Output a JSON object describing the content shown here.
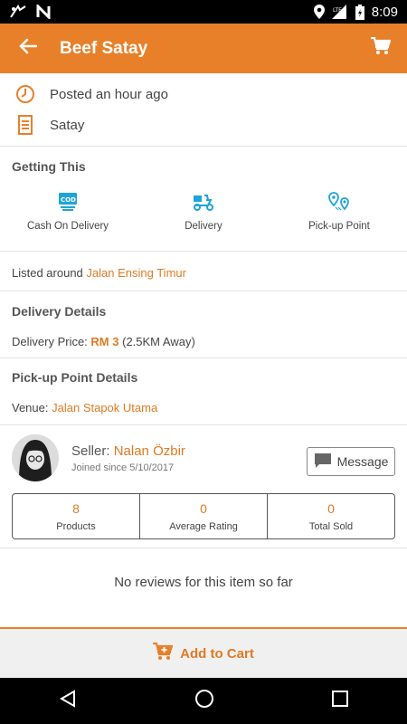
{
  "status_bar": {
    "time": "8:09",
    "network": "LTE"
  },
  "app_bar": {
    "title": "Beef Satay"
  },
  "item": {
    "posted": "Posted an hour ago",
    "category": "Satay"
  },
  "getting": {
    "title": "Getting This",
    "options": [
      {
        "label": "Cash On Delivery",
        "icon": "cod-icon"
      },
      {
        "label": "Delivery",
        "icon": "delivery-scooter-icon"
      },
      {
        "label": "Pick-up Point",
        "icon": "map-pin-icon"
      }
    ]
  },
  "location": {
    "prefix": "Listed around",
    "place": "Jalan Ensing Timur"
  },
  "delivery": {
    "title": "Delivery Details",
    "price_label": "Delivery Price:",
    "price": "RM 3",
    "distance": "(2.5KM Away)"
  },
  "pickup": {
    "title": "Pick-up Point Details",
    "venue_label": "Venue:",
    "venue": "Jalan Stapok Utama"
  },
  "seller": {
    "label": "Seller:",
    "name": "Nalan Özbir",
    "joined": "Joined since 5/10/2017",
    "message_label": "Message",
    "stats": [
      {
        "value": "8",
        "label": "Products"
      },
      {
        "value": "0",
        "label": "Average Rating"
      },
      {
        "value": "0",
        "label": "Total Sold"
      }
    ]
  },
  "reviews": {
    "empty_text": "No reviews for this item so far"
  },
  "bottom": {
    "add_to_cart": "Add to Cart"
  },
  "colors": {
    "accent": "#e8802a",
    "link": "#e07a22",
    "cod_blue": "#1fa3d8"
  }
}
